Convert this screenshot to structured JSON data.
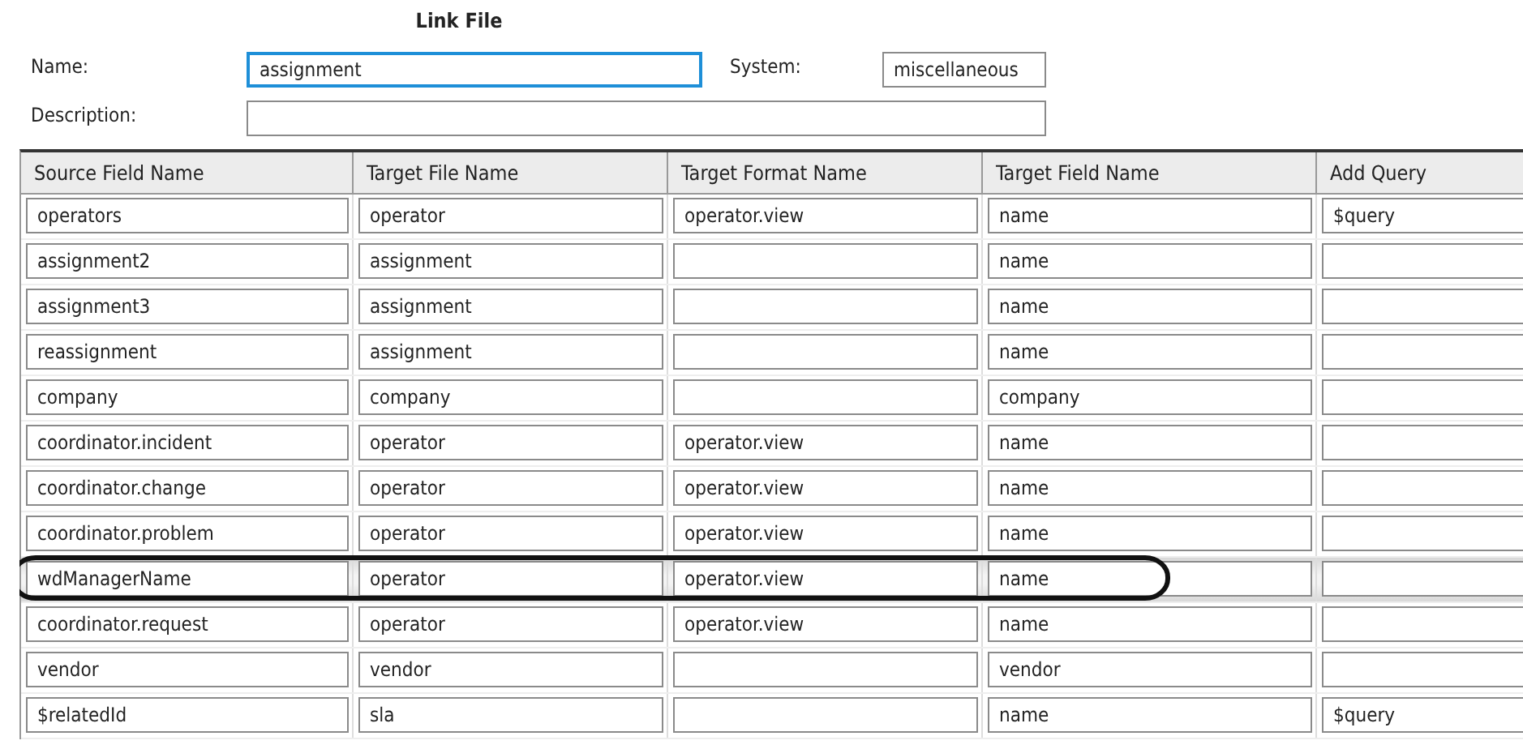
{
  "title": "Link File",
  "form": {
    "name": {
      "label": "Name:",
      "value": "assignment",
      "focused": true
    },
    "system": {
      "label": "System:",
      "value": "miscellaneous"
    },
    "description": {
      "label": "Description:"
    }
  },
  "table": {
    "columns": [
      "Source Field Name",
      "Target File Name",
      "Target Format Name",
      "Target Field Name",
      "Add Query"
    ],
    "rows": [
      {
        "source": "operators",
        "file": "operator",
        "format": "operator.view",
        "field": "name",
        "query": "$query",
        "highlighted": false
      },
      {
        "source": "assignment2",
        "file": "assignment",
        "field": "name",
        "highlighted": false
      },
      {
        "source": "assignment3",
        "file": "assignment",
        "field": "name",
        "highlighted": false
      },
      {
        "source": "reassignment",
        "file": "assignment",
        "field": "name",
        "highlighted": false
      },
      {
        "source": "company",
        "file": "company",
        "field": "company",
        "highlighted": false
      },
      {
        "source": "coordinator.incident",
        "file": "operator",
        "format": "operator.view",
        "field": "name",
        "highlighted": false
      },
      {
        "source": "coordinator.change",
        "file": "operator",
        "format": "operator.view",
        "field": "name",
        "highlighted": false
      },
      {
        "source": "coordinator.problem",
        "file": "operator",
        "format": "operator.view",
        "field": "name",
        "highlighted": false
      },
      {
        "source": "wdManagerName",
        "file": "operator",
        "format": "operator.view",
        "field": "name",
        "highlighted": true
      },
      {
        "source": "coordinator.request",
        "file": "operator",
        "format": "operator.view",
        "field": "name",
        "highlighted": false
      },
      {
        "source": "vendor",
        "file": "vendor",
        "field": "vendor",
        "highlighted": false
      },
      {
        "source": "$relatedId",
        "file": "sla",
        "field": "name",
        "query": "$query",
        "highlighted": false
      }
    ]
  }
}
